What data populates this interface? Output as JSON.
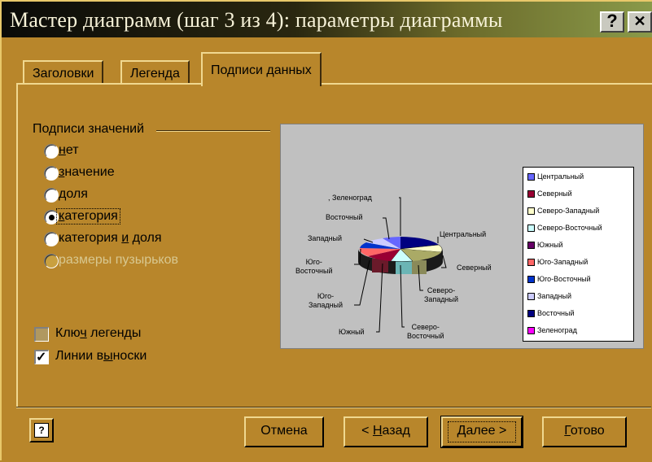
{
  "window": {
    "title": "Мастер диаграмм (шаг 3 из 4): параметры диаграммы",
    "help_glyph": "?",
    "close_glyph": "✕"
  },
  "tabs": [
    {
      "label": "Заголовки",
      "active": false
    },
    {
      "label": "Легенда",
      "active": false
    },
    {
      "label": "Подписи данных",
      "active": true
    }
  ],
  "value_labels": {
    "group_title": "Подписи значений",
    "options": [
      {
        "label": "нет",
        "selected": false,
        "enabled": true
      },
      {
        "label": "значение",
        "selected": false,
        "enabled": true
      },
      {
        "label": "доля",
        "selected": false,
        "enabled": true
      },
      {
        "label": "категория",
        "selected": true,
        "enabled": true
      },
      {
        "label": "категория и доля",
        "selected": false,
        "enabled": true
      },
      {
        "label": "размеры пузырьков",
        "selected": false,
        "enabled": false
      }
    ]
  },
  "checkboxes": [
    {
      "label": "Ключ легенды",
      "checked": false
    },
    {
      "label": "Линии выноски",
      "checked": true
    }
  ],
  "preview": {
    "legend": [
      {
        "label": "Центральный",
        "color": "#6666ff"
      },
      {
        "label": "Северный",
        "color": "#990033"
      },
      {
        "label": "Северо-Западный",
        "color": "#ffffcc"
      },
      {
        "label": "Северо-Восточный",
        "color": "#ccffff"
      },
      {
        "label": "Южный",
        "color": "#660066"
      },
      {
        "label": "Юго-Западный",
        "color": "#ff6666"
      },
      {
        "label": "Юго-Восточный",
        "color": "#0033cc"
      },
      {
        "label": "Западный",
        "color": "#ccccff"
      },
      {
        "label": "Восточный",
        "color": "#000080"
      },
      {
        "label": "Зеленоград",
        "color": "#ff00ff"
      }
    ],
    "callouts": {
      "zelenograd": "Зеленоград",
      "vostochny": "Восточный",
      "zapadny": "Западный",
      "yugo_vostochny_1": "Юго-",
      "yugo_vostochny_2": "Восточный",
      "yugo_zapadny_1": "Юго-",
      "yugo_zapadny_2": "Западный",
      "yuzhny": "Южный",
      "centralny": "Центральный",
      "severny": "Северный",
      "severo_zapadny_1": "Северо-",
      "severo_zapadny_2": "Западный",
      "severo_vostochny_1": "Северо-",
      "severo_vostochny_2": "Восточный"
    }
  },
  "buttons": {
    "help": "?",
    "cancel": "Отмена",
    "back": "< Назад",
    "next": "Далее >",
    "finish": "Готово"
  }
}
